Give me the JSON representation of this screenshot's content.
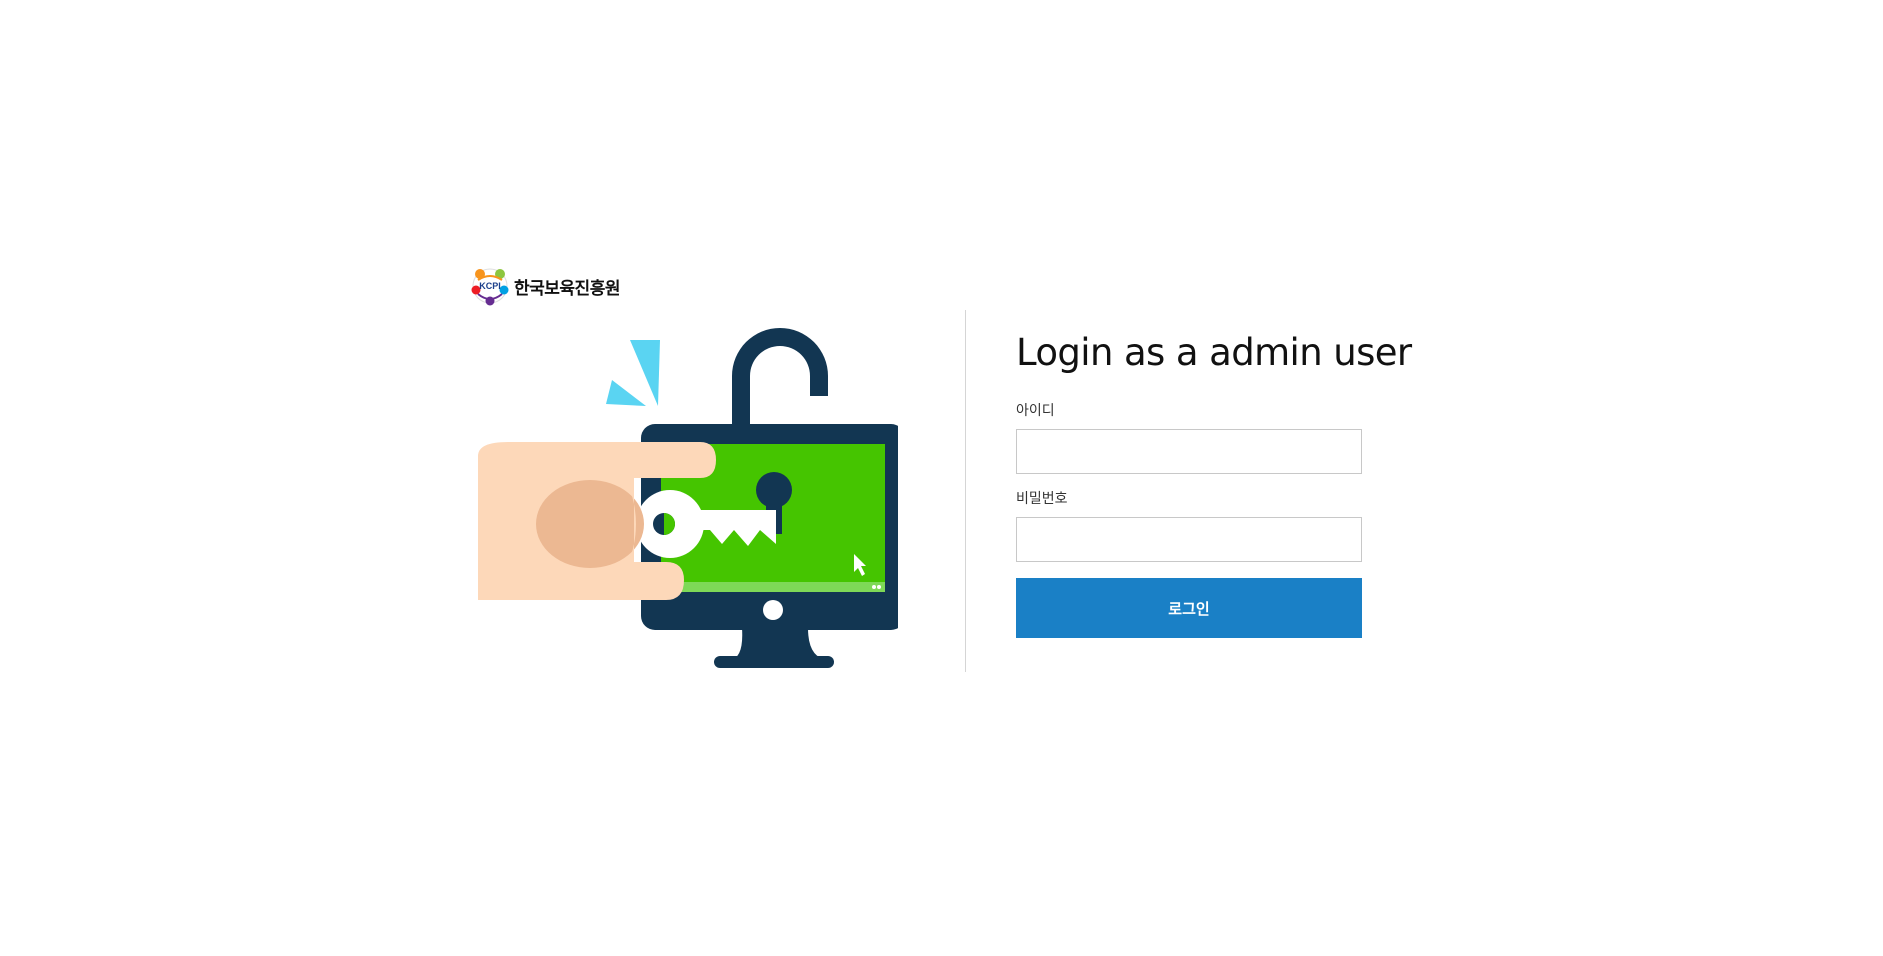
{
  "branding": {
    "logo_mark": "KCPI",
    "logo_text": "한국보육진흥원",
    "logo_colors": [
      "#f7941d",
      "#8dc63f",
      "#00a0e3",
      "#662d91",
      "#ed1c24"
    ]
  },
  "illustration": {
    "icon": "unlocked-monitor-key-icon",
    "colors": {
      "navy": "#123652",
      "screen_green": "#45c500",
      "screen_strip": "#7ed957",
      "cyan": "#5ad4f2",
      "skin": "#fdd8b9",
      "skin_shadow": "#ecb892",
      "key": "#ffffff"
    }
  },
  "login": {
    "title": "Login as a admin user",
    "username_label": "아이디",
    "username_value": "",
    "password_label": "비밀번호",
    "password_value": "",
    "submit_label": "로그인",
    "accent_color": "#1a80c6"
  }
}
